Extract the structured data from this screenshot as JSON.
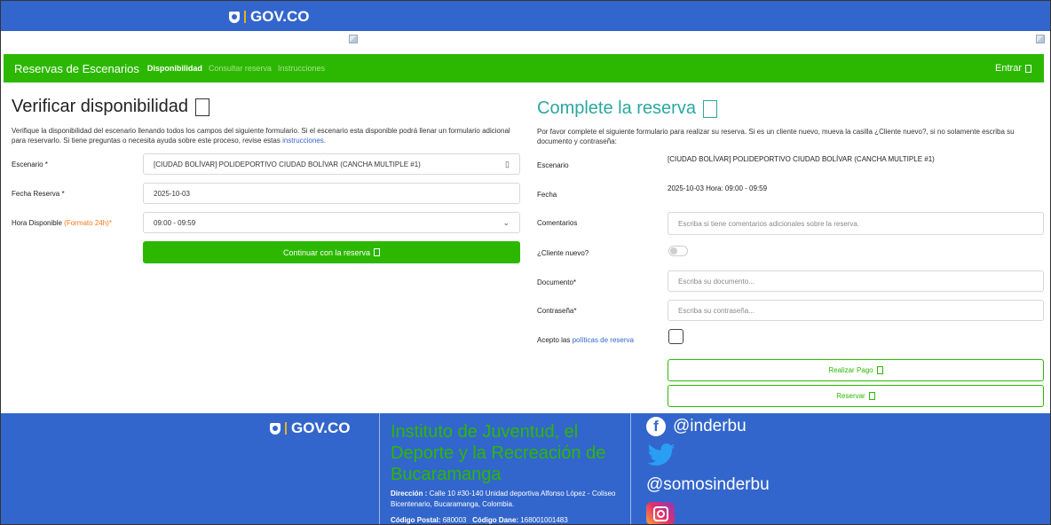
{
  "gov_bar": {
    "logo_text": "GOV.CO"
  },
  "nav": {
    "brand": "Reservas de Escenarios",
    "links": [
      "Disponibilidad",
      "Consultar reserva",
      "Instrucciones"
    ],
    "login": "Entrar"
  },
  "availability": {
    "title": "Verificar disponibilidad",
    "description": "Verifique la disponibilidad del escenario llenando todos los campos del siguiente formulario. Si el escenario esta disponible podrá llenar un formulario adicional para reservarlo. Si tiene preguntas o necesita ayuda sobre este proceso, revise estas",
    "description_link": "instrucciones.",
    "scenario_label": "Escenario *",
    "scenario_value": "[CIUDAD BOLÍVAR] POLIDEPORTIVO CIUDAD BOLÍVAR (CANCHA MULTIPLE #1)",
    "date_label": "Fecha Reserva *",
    "date_value": "2025-10-03",
    "hour_label": "Hora Disponible",
    "hour_format": "(Formato 24h)",
    "hour_required": "*",
    "hour_value": "09:00 - 09:59",
    "continue_button": "Continuar con la reserva"
  },
  "reservation": {
    "title": "Complete la reserva",
    "description": "Por favor complete el siguiente formulario para realizar su reserva. Si es un cliente nuevo, mueva la casilla ¿Cliente nuevo?, si no solamente escriba su documento y contraseña:",
    "scenario_label": "Escenario",
    "scenario_value": "[CIUDAD BOLÍVAR] POLIDEPORTIVO CIUDAD BOLÍVAR (CANCHA MULTIPLE #1)",
    "date_label": "Fecha",
    "date_value": "2025-10-03 Hora: 09:00 - 09:59",
    "comments_label": "Comentarios",
    "comments_placeholder": "Escriba si tiene comentarios adicionales sobre la reserva.",
    "new_client_label": "¿Cliente nuevo?",
    "new_client_on": false,
    "document_label": "Documento*",
    "document_placeholder": "Escriba su documento...",
    "password_label": "Contraseña*",
    "password_placeholder": "Escriba su contraseña...",
    "accept_prefix": "Acepto las",
    "accept_link": "políticas de reserva",
    "accept_checked": false,
    "pay_button": "Realizar Pago",
    "reserve_button": "Reservar"
  },
  "footer": {
    "logo_text": "GOV.CO",
    "institution": "Instituto de Juventud, el Deporte y la Recreación de Bucaramanga",
    "address_label": "Dirección :",
    "address_value": "Calle 10 #30-140 Unidad deportiva Alfonso López - Coliseo Bicentenario, Bucaramanga, Colombia.",
    "postal_label": "Código Postal:",
    "postal_value": "680003",
    "dane_label": "Código Dane:",
    "dane_value": "168001001483",
    "facebook": "@inderbu",
    "twitter": "@somosinderbu"
  },
  "colors": {
    "gov_blue": "#3366cc",
    "brand_green": "#2cb800",
    "title_teal": "#2aa8a0",
    "accent_orange": "#f07a1a"
  }
}
